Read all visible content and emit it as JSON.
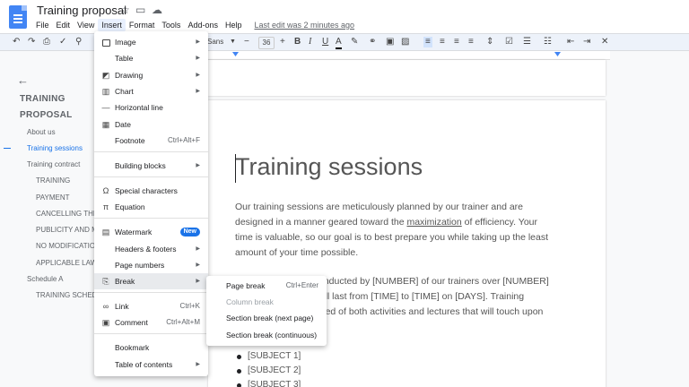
{
  "doc": {
    "title": "Training proposal",
    "last_edit": "Last edit was 2 minutes ago"
  },
  "menubar": [
    "File",
    "Edit",
    "View",
    "Insert",
    "Format",
    "Tools",
    "Add-ons",
    "Help"
  ],
  "toolbar": {
    "font": "Sans",
    "font_size": "36"
  },
  "outline": {
    "title_1": "TRAINING",
    "title_2": "PROPOSAL",
    "items": [
      "About us",
      "Training sessions",
      "Training contract",
      "TRAINING",
      "PAYMENT",
      "CANCELLING THE",
      "PUBLICITY AND M",
      "NO MODIFICATION",
      "APPLICABLE LAW",
      "Schedule A",
      "TRAINING SCHED"
    ]
  },
  "page": {
    "heading": "Training sessions",
    "para1_a": "Our training sessions are meticulously planned by our trainer and are designed in a manner geared toward the ",
    "para1_link": "maximization",
    "para1_b": " of efficiency. Your time is valuable, so our goal is to best prepare you while taking up the least amount of your time possible.",
    "p2_l1": "onducted by [NUMBER] of our trainers over [NUMBER]",
    "p2_l2": "vill last from [TIME] to [TIME] on [DAYS]. Training",
    "p2_l3": "ised of both activities and lectures that will touch upon",
    "bullets": [
      "[SUBJECT 1]",
      "[SUBJECT 2]",
      "[SUBJECT 3]"
    ]
  },
  "insert_menu": {
    "image": "Image",
    "table": "Table",
    "drawing": "Drawing",
    "chart": "Chart",
    "horizontal_line": "Horizontal line",
    "date": "Date",
    "footnote": "Footnote",
    "footnote_sc": "Ctrl+Alt+F",
    "building_blocks": "Building blocks",
    "special_characters": "Special characters",
    "equation": "Equation",
    "watermark": "Watermark",
    "new_badge": "New",
    "headers_footers": "Headers & footers",
    "page_numbers": "Page numbers",
    "break": "Break",
    "link": "Link",
    "link_sc": "Ctrl+K",
    "comment": "Comment",
    "comment_sc": "Ctrl+Alt+M",
    "bookmark": "Bookmark",
    "table_of_contents": "Table of contents"
  },
  "break_submenu": {
    "page_break": "Page break",
    "page_break_sc": "Ctrl+Enter",
    "column_break": "Column break",
    "section_next": "Section break (next page)",
    "section_cont": "Section break (continuous)"
  }
}
